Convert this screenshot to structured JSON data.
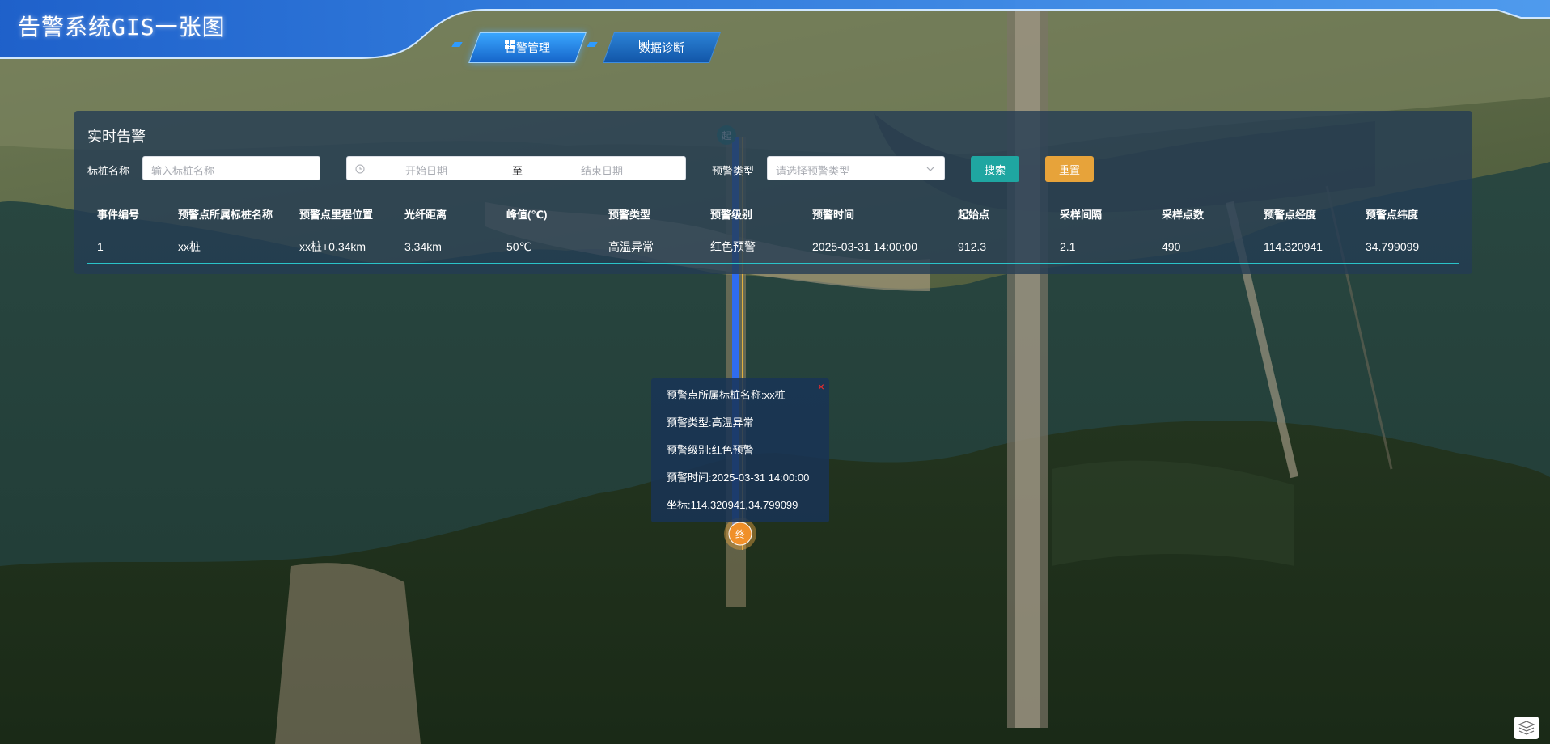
{
  "app": {
    "title": "告警系统GIS一张图"
  },
  "nav": {
    "tabs": [
      {
        "label": "告警管理",
        "icon": "grid-icon",
        "active": true
      },
      {
        "label": "数据诊断",
        "icon": "chart-icon",
        "active": false
      }
    ]
  },
  "alarm_panel": {
    "title": "实时告警",
    "filters": {
      "pile_label": "标桩名称",
      "pile_placeholder": "输入标桩名称",
      "start_placeholder": "开始日期",
      "range_separator": "至",
      "end_placeholder": "结束日期",
      "type_label": "预警类型",
      "type_placeholder": "请选择预警类型",
      "search_label": "搜索",
      "reset_label": "重置"
    },
    "table": {
      "headers": [
        "事件编号",
        "预警点所属标桩名称",
        "预警点里程位置",
        "光纤距离",
        "峰值(℃)",
        "预警类型",
        "预警级别",
        "预警时间",
        "起始点",
        "采样间隔",
        "采样点数",
        "预警点经度",
        "预警点纬度"
      ],
      "rows": [
        [
          "1",
          "xx桩",
          "xx桩+0.34km",
          "3.34km",
          "50℃",
          "高温异常",
          "红色预警",
          "2025-03-31 14:00:00",
          "912.3",
          "2.1",
          "490",
          "114.320941",
          "34.799099"
        ]
      ]
    }
  },
  "map": {
    "start_marker": "起",
    "end_marker": "终"
  },
  "popup": {
    "lines": [
      "预警点所属标桩名称:xx桩",
      "预警类型:高温异常",
      "预警级别:红色预警",
      "预警时间:2025-03-31 14:00:00",
      "坐标:114.320941,34.799099"
    ],
    "close": "×"
  },
  "colors": {
    "accent_teal": "#1fa6a1",
    "reset_orange": "#e7a33a",
    "route_blue": "#2f6cf0",
    "alarm_red": "#ff2b2b"
  }
}
